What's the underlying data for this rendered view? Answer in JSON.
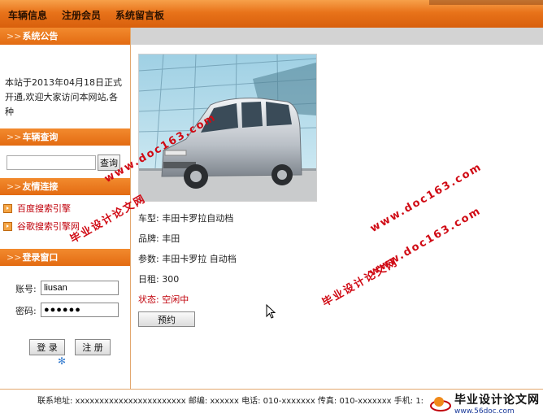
{
  "nav": {
    "items": [
      "车辆信息",
      "注册会员",
      "系统留言板"
    ]
  },
  "sidebar": {
    "arrow": ">>",
    "notice": {
      "title": "系统公告",
      "text": "本站于2013年04月18日正式开通,欢迎大家访问本网站,各种"
    },
    "search": {
      "title": "车辆查询",
      "query_value": "",
      "button": "查询"
    },
    "links": {
      "title": "友情连接",
      "items": [
        "百度搜索引擎",
        "谷歌搜索引擎网"
      ]
    },
    "login": {
      "title": "登录窗口",
      "account_label": "账号:",
      "account_value": "liusan",
      "password_label": "密码:",
      "password_value": "●●●●●●",
      "login_button": "登 录",
      "register_button": "注 册"
    }
  },
  "car": {
    "type": "车型: 丰田卡罗拉自动档",
    "brand": "品牌: 丰田",
    "params": "参数: 丰田卡罗拉 自动档",
    "rent": "日租: 300",
    "status": "状态: 空闲中",
    "book_button": "预约"
  },
  "footer": {
    "text": "联系地址: xxxxxxxxxxxxxxxxxxxxxxx    邮编: xxxxxx 电话: 010-xxxxxxx    传真: 010-xxxxxxx    手机: 1:",
    "logo_text": "毕业设计论文网",
    "logo_url": "www.56doc.com"
  },
  "watermarks": [
    "www.doc163.com",
    "毕业设计论文网",
    "www.doc163.com",
    "毕业设计论文网",
    "www.doc163.com"
  ],
  "colors": {
    "accent": "#e8731a",
    "link": "#c0000a"
  }
}
